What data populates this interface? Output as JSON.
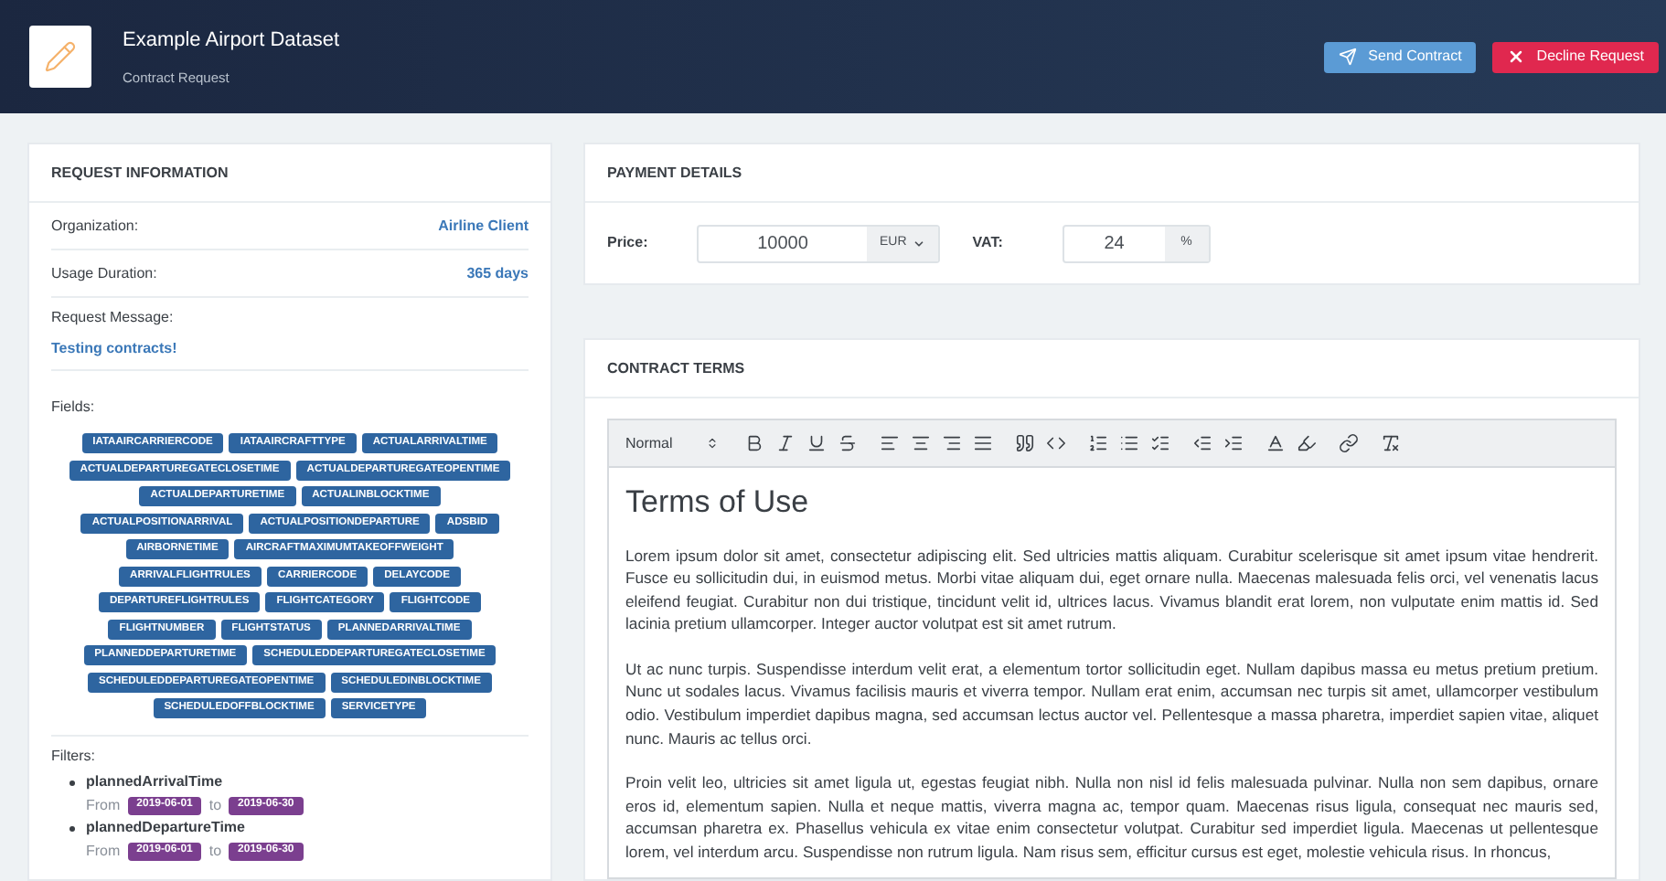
{
  "header": {
    "title": "Example Airport Dataset",
    "subtitle": "Contract Request",
    "actions": [
      {
        "kind": "send",
        "label": "Send Contract"
      },
      {
        "kind": "decline",
        "label": "Decline Request"
      }
    ]
  },
  "request_information": {
    "title": "REQUEST INFORMATION",
    "rows": [
      {
        "label": "Organization:",
        "value": "Airline Client"
      },
      {
        "label": "Usage Duration:",
        "value": "365 days"
      }
    ],
    "message_label": "Request Message:",
    "message": "Testing contracts!",
    "fields_label": "Fields:",
    "fields": [
      "IATAAIRCARRIERCODE",
      "IATAAIRCRAFTTYPE",
      "ACTUALARRIVALTIME",
      "ACTUALDEPARTUREGATECLOSETIME",
      "ACTUALDEPARTUREGATEOPENTIME",
      "ACTUALDEPARTURETIME",
      "ACTUALINBLOCKTIME",
      "ACTUALPOSITIONARRIVAL",
      "ACTUALPOSITIONDEPARTURE",
      "ADSBID",
      "AIRBORNETIME",
      "AIRCRAFTMAXIMUMTAKEOFFWEIGHT",
      "ARRIVALFLIGHTRULES",
      "CARRIERCODE",
      "DELAYCODE",
      "DEPARTUREFLIGHTRULES",
      "FLIGHTCATEGORY",
      "FLIGHTCODE",
      "FLIGHTNUMBER",
      "FLIGHTSTATUS",
      "PLANNEDARRIVALTIME",
      "PLANNEDDEPARTURETIME",
      "SCHEDULEDDEPARTUREGATECLOSETIME",
      "SCHEDULEDDEPARTUREGATEOPENTIME",
      "SCHEDULEDINBLOCKTIME",
      "SCHEDULEDOFFBLOCKTIME",
      "SERVICETYPE"
    ],
    "filters_label": "Filters:",
    "filters": [
      {
        "name": "plannedArrivalTime",
        "from_label": "From",
        "from": "2019-06-01",
        "to_label": "to",
        "to": "2019-06-30"
      },
      {
        "name": "plannedDepartureTime",
        "from_label": "From",
        "from": "2019-06-01",
        "to_label": "to",
        "to": "2019-06-30"
      }
    ]
  },
  "payment_details": {
    "title": "PAYMENT DETAILS",
    "price_label": "Price:",
    "price": "10000",
    "currency": "EUR",
    "vat_label": "VAT:",
    "vat": "24",
    "vat_unit": "%"
  },
  "contract_terms": {
    "title": "CONTRACT TERMS",
    "format": "Normal",
    "heading": "Terms of Use",
    "paragraphs": [
      "Lorem ipsum dolor sit amet, consectetur adipiscing elit. Sed ultricies mattis aliquam. Curabitur scelerisque sit amet ipsum vitae hendrerit. Fusce eu sollicitudin dui, in euismod metus. Morbi vitae aliquam dui, eget ornare nulla. Maecenas malesuada felis orci, vel venenatis lacus eleifend feugiat. Curabitur non dui tristique, tincidunt velit id, ultrices lacus. Vivamus blandit erat lorem, non vulputate enim mattis id. Sed lacinia pretium ullamcorper. Integer auctor volutpat est sit amet rutrum.",
      "Ut ac nunc turpis. Suspendisse interdum velit erat, a elementum tortor sollicitudin eget. Nullam dapibus massa eu metus pretium pretium. Nunc ut sodales lacus. Vivamus facilisis mauris et viverra tempor. Nullam erat enim, accumsan nec turpis sit amet, ullamcorper vestibulum odio. Vestibulum imperdiet dapibus magna, sed accumsan lectus auctor vel. Pellentesque a massa pharetra, imperdiet sapien vitae, aliquet nunc. Mauris ac tellus orci.",
      "Proin velit leo, ultricies sit amet ligula ut, egestas feugiat nibh. Nulla non nisl id felis malesuada pulvinar. Nulla non sem dapibus, ornare eros id, elementum sapien. Nulla et neque mattis, viverra magna ac, tempor quam. Maecenas risus ligula, consequat nec mauris sed, accumsan pharetra ex. Phasellus vehicula ex vitae enim consectetur volutpat. Curabitur sed imperdiet ligula. Maecenas ut pellentesque lorem, vel interdum arcu. Suspendisse non rutrum ligula. Nam risus sem, efficitur cursus est eget, molestie vehicula risus. In rhoncus,"
    ]
  }
}
